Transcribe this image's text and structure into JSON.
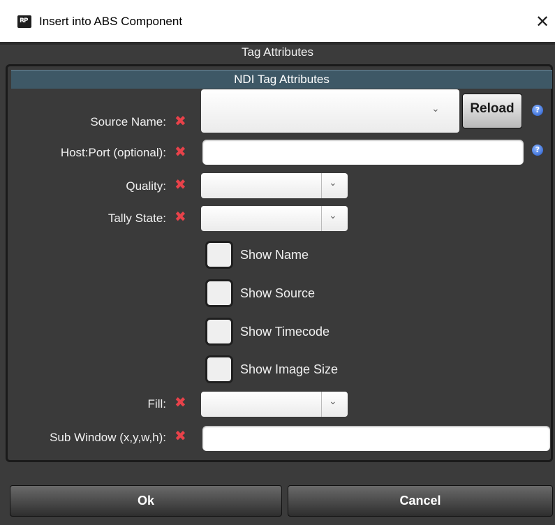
{
  "window": {
    "title": "Insert into ABS Component",
    "app_icon": "ABS application icon",
    "close_label": "✕"
  },
  "section_title": "Tag Attributes",
  "panel": {
    "header": "NDI Tag Attributes",
    "fields": {
      "source_name": {
        "label": "Source Name:",
        "value": ""
      },
      "host_port": {
        "label": "Host:Port (optional):",
        "value": ""
      },
      "quality": {
        "label": "Quality:",
        "value": ""
      },
      "tally_state": {
        "label": "Tally State:",
        "value": ""
      },
      "fill": {
        "label": "Fill:",
        "value": ""
      },
      "sub_window": {
        "label": "Sub Window (x,y,w,h):",
        "value": ""
      }
    },
    "reload_label": "Reload",
    "required_mark": "✖",
    "help_mark": "?",
    "dropdown_arrow": "⌄",
    "checkboxes": [
      {
        "label": "Show Name",
        "checked": false
      },
      {
        "label": "Show Source",
        "checked": false
      },
      {
        "label": "Show Timecode",
        "checked": false
      },
      {
        "label": "Show Image Size",
        "checked": false
      }
    ]
  },
  "buttons": {
    "ok": "Ok",
    "cancel": "Cancel"
  },
  "colors": {
    "background": "#3b3b3b",
    "panel_header": "#3e5866",
    "required_mark": "#e8424a",
    "help_icon": "#1f55c8"
  }
}
